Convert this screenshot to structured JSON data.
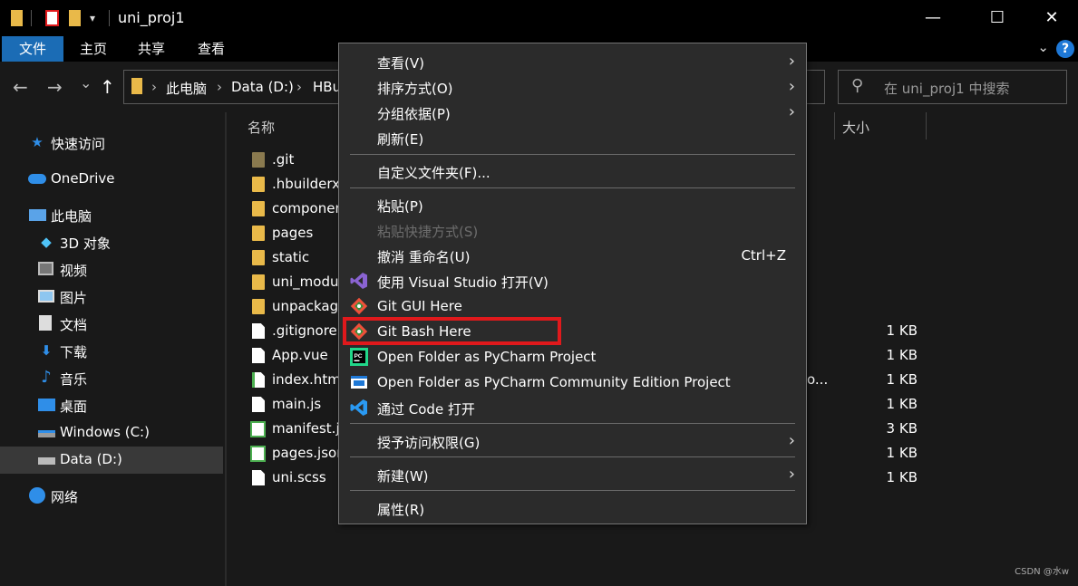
{
  "window": {
    "title": "uni_proj1",
    "minimize_glyph": "—",
    "maximize_glyph": "☐",
    "close_glyph": "✕"
  },
  "ribbon": {
    "tabs": [
      "文件",
      "主页",
      "共享",
      "查看"
    ],
    "collapse_glyph": "⌄",
    "help_glyph": "?"
  },
  "nav": {
    "back_glyph": "←",
    "forward_glyph": "→",
    "recent_glyph": "⌄",
    "up_glyph": "↑",
    "path": [
      "此电脑",
      "Data (D:)",
      "HBu"
    ],
    "path_separator": "›",
    "search_placeholder": "在 uni_proj1 中搜索",
    "search_icon_glyph": "⚲"
  },
  "sidebar": {
    "items": [
      {
        "label": "快速访问",
        "icon": "star-icon"
      },
      {
        "label": "OneDrive",
        "icon": "cloud-icon"
      },
      {
        "label": "此电脑",
        "icon": "computer-icon"
      },
      {
        "label": "3D 对象",
        "icon": "cube-icon"
      },
      {
        "label": "视频",
        "icon": "video-icon"
      },
      {
        "label": "图片",
        "icon": "picture-icon"
      },
      {
        "label": "文档",
        "icon": "document-icon"
      },
      {
        "label": "下载",
        "icon": "download-icon"
      },
      {
        "label": "音乐",
        "icon": "music-icon"
      },
      {
        "label": "桌面",
        "icon": "desktop-icon"
      },
      {
        "label": "Windows (C:)",
        "icon": "drive-icon"
      },
      {
        "label": "Data (D:)",
        "icon": "drive-icon"
      },
      {
        "label": "网络",
        "icon": "network-icon"
      }
    ],
    "selected": "Data (D:)"
  },
  "file_list": {
    "columns": {
      "name": "名称",
      "size": "大小"
    },
    "files": [
      {
        "name": ".git",
        "type": "folder-dark",
        "size": ""
      },
      {
        "name": ".hbuilderx",
        "type": "folder",
        "size": ""
      },
      {
        "name": "componer",
        "type": "folder",
        "size": ""
      },
      {
        "name": "pages",
        "type": "folder",
        "size": ""
      },
      {
        "name": "static",
        "type": "folder",
        "size": ""
      },
      {
        "name": "uni_modu",
        "type": "folder",
        "size": ""
      },
      {
        "name": "unpackage",
        "type": "folder",
        "size": ""
      },
      {
        "name": ".gitignore",
        "type": "doc",
        "size": "1 KB"
      },
      {
        "name": "App.vue",
        "type": "doc",
        "size": "1 KB"
      },
      {
        "name": "index.htm",
        "type": "html",
        "size": "1 KB",
        "extra": "o..."
      },
      {
        "name": "main.js",
        "type": "doc",
        "size": "1 KB"
      },
      {
        "name": "manifest.js",
        "type": "greendoc",
        "size": "3 KB"
      },
      {
        "name": "pages.json",
        "type": "greendoc",
        "size": "1 KB"
      },
      {
        "name": "uni.scss",
        "type": "doc",
        "size": "1 KB"
      }
    ]
  },
  "context_menu": {
    "groups": [
      [
        {
          "label": "查看(V)",
          "submenu": true
        },
        {
          "label": "排序方式(O)",
          "submenu": true
        },
        {
          "label": "分组依据(P)",
          "submenu": true
        },
        {
          "label": "刷新(E)"
        }
      ],
      [
        {
          "label": "自定义文件夹(F)..."
        }
      ],
      [
        {
          "label": "粘贴(P)"
        },
        {
          "label": "粘贴快捷方式(S)",
          "disabled": true
        },
        {
          "label": "撤消 重命名(U)",
          "shortcut": "Ctrl+Z"
        },
        {
          "label": "使用 Visual Studio 打开(V)",
          "icon": "visual-studio-icon"
        },
        {
          "label": "Git GUI Here",
          "icon": "git-icon"
        },
        {
          "label": "Git Bash Here",
          "icon": "git-icon",
          "highlighted": true
        },
        {
          "label": "Open Folder as PyCharm Project",
          "icon": "pycharm-icon"
        },
        {
          "label": "Open Folder as PyCharm Community Edition Project",
          "icon": "pycharm-ce-icon"
        },
        {
          "label": "通过 Code 打开",
          "icon": "vscode-icon"
        }
      ],
      [
        {
          "label": "授予访问权限(G)",
          "submenu": true
        }
      ],
      [
        {
          "label": "新建(W)",
          "submenu": true
        }
      ],
      [
        {
          "label": "属性(R)"
        }
      ]
    ],
    "highlight_color": "#e0191c"
  },
  "watermark": "CSDN @水w",
  "colors": {
    "accent_blue": "#1b6cb5",
    "folder_yellow": "#e9b949",
    "background": "#191919",
    "menu_background": "#2b2b2b"
  }
}
